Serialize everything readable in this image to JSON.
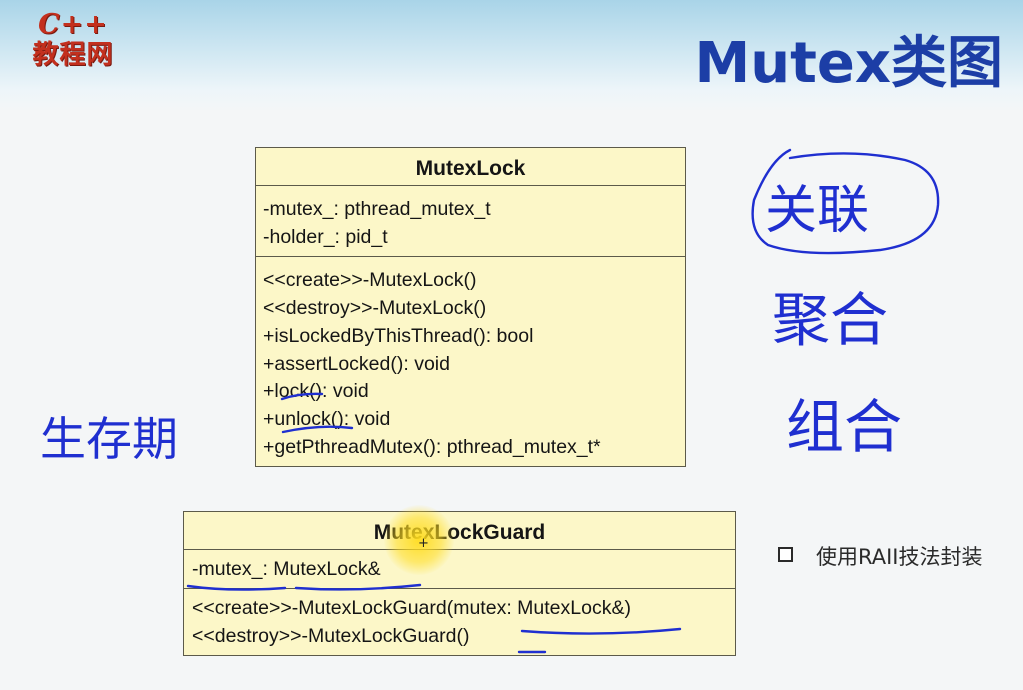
{
  "logo": {
    "line1": "C++",
    "line2": "教程网"
  },
  "title": "Mutex类图",
  "mutex_lock": {
    "name": "MutexLock",
    "attributes": [
      "-mutex_: pthread_mutex_t",
      "-holder_: pid_t"
    ],
    "operations": [
      "<<create>>-MutexLock()",
      "<<destroy>>-MutexLock()",
      "+isLockedByThisThread(): bool",
      "+assertLocked(): void",
      "+lock(): void",
      "+unlock(): void",
      "+getPthreadMutex(): pthread_mutex_t*"
    ]
  },
  "mutex_lock_guard": {
    "name": "MutexLockGuard",
    "attributes": [
      "-mutex_: MutexLock&"
    ],
    "operations": [
      "<<create>>-MutexLockGuard(mutex: MutexLock&)",
      "<<destroy>>-MutexLockGuard()"
    ]
  },
  "bullet": {
    "text": "使用RAII技法封装"
  },
  "handwriting": {
    "association": "关联",
    "aggregation": "聚合",
    "composition": "组合",
    "lifetime": "生存期",
    "ink_color": "#1f2fd0"
  }
}
